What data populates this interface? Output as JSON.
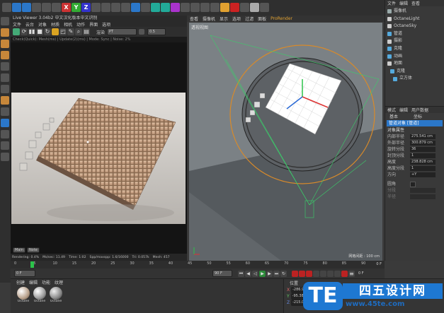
{
  "top_toolbar": {
    "icons": [
      "undo-icon",
      "select-icon",
      "move-icon",
      "scale-icon",
      "rotate-icon",
      "recent-icon",
      "x-axis-icon",
      "y-axis-icon",
      "z-axis-icon",
      "coord-icon",
      "render-icon",
      "render-view-icon",
      "render-settings-icon",
      "cube-icon",
      "pen-icon",
      "subdivide-icon",
      "array-icon",
      "deformer-icon",
      "scene-icon",
      "camera-icon",
      "light-icon",
      "grid-icon",
      "sun-icon",
      "record-icon",
      "target-icon",
      "sphere-icon",
      "cloud-icon"
    ],
    "axis_letters": [
      "X",
      "Y",
      "Z"
    ]
  },
  "render_window": {
    "title": "Live Viewer 3.04b2 中文汉化版本中文识别",
    "menu": [
      "文件",
      "云台",
      "对象",
      "材质",
      "相机",
      "动作",
      "界面",
      "选项"
    ],
    "status_line": "Check(Quick): Mesh(ms) | Update(2)(ms) | Mode: Sync | Noise: 2%",
    "render_label": "渲染",
    "pt_option": "PT",
    "scale_value": "0.5",
    "view_buttons": [
      "Main",
      "Note"
    ],
    "footer_stats": [
      "Rendering: 0.4%",
      "Ms/sec: 11.49",
      "Time: 1:02",
      "Spp/maxspp: 1.6/16000",
      "Tri: 0.057k",
      "Mesh: 457"
    ]
  },
  "viewport": {
    "menu": [
      "查看",
      "摄像机",
      "显示",
      "选项",
      "过滤",
      "面板",
      "ProRender"
    ],
    "camera_label": "透视视图",
    "grid_spacing": "网格间距 : 100 cm"
  },
  "object_manager": {
    "menu": [
      "文件",
      "编辑",
      "查看"
    ],
    "items": [
      {
        "label": "摄像机",
        "color": "#9aa"
      },
      {
        "label": "OctaneLight",
        "color": "#ccc"
      },
      {
        "label": "OctaneSky",
        "color": "#ccc"
      },
      {
        "label": "管道",
        "color": "#5ad"
      },
      {
        "label": "摄影",
        "color": "#ccc"
      },
      {
        "label": "克隆",
        "color": "#5ad"
      },
      {
        "label": "动画",
        "color": "#5ad"
      },
      {
        "label": "地面",
        "color": "#ccc"
      },
      {
        "label": "克隆",
        "color": "#5ad"
      },
      {
        "label": "立方体",
        "color": "#5ad"
      }
    ]
  },
  "attribute_manager": {
    "menu": [
      "模式",
      "编辑",
      "用户数据"
    ],
    "tabs": [
      "基本",
      "坐标"
    ],
    "object_title": "管道对象 [管道]",
    "section": "对象属性",
    "rows": [
      {
        "label": "内部半径",
        "value": "275.541 cm"
      },
      {
        "label": "外部半径",
        "value": "300.879 cm"
      },
      {
        "label": "旋转分段",
        "value": "36"
      },
      {
        "label": "封顶分段",
        "value": "1"
      },
      {
        "label": "高度",
        "value": "238.828 cm"
      },
      {
        "label": "高度分段",
        "value": "1"
      },
      {
        "label": "方向",
        "value": "+Y"
      }
    ],
    "extra_rows": [
      "圆角",
      "分段",
      "半径"
    ]
  },
  "timeline": {
    "ticks": [
      "0",
      "5",
      "10",
      "15",
      "20",
      "25",
      "30",
      "35",
      "40",
      "45",
      "50",
      "55",
      "60",
      "65",
      "70",
      "75",
      "80",
      "85",
      "90"
    ],
    "current_frame": "0 F",
    "start_field": "0 F",
    "end_field": "90 F",
    "end_label": "0 F"
  },
  "material_manager": {
    "menu": [
      "创建",
      "编辑",
      "功能",
      "纹理"
    ],
    "materials": [
      "Octane",
      "Octane",
      "Octane"
    ]
  },
  "coordinates": {
    "header": "位置",
    "x": "-286.9",
    "y": "-95.38",
    "z": "-215.06"
  },
  "watermark": {
    "badge": "TE",
    "title": "四五设计网",
    "url": "www.45te.com"
  },
  "colors": {
    "accent_blue": "#2b77c9",
    "octane_orange": "#e0a030",
    "viewport_bg": "#7e8488",
    "render_bg": "#d8d4cf"
  }
}
